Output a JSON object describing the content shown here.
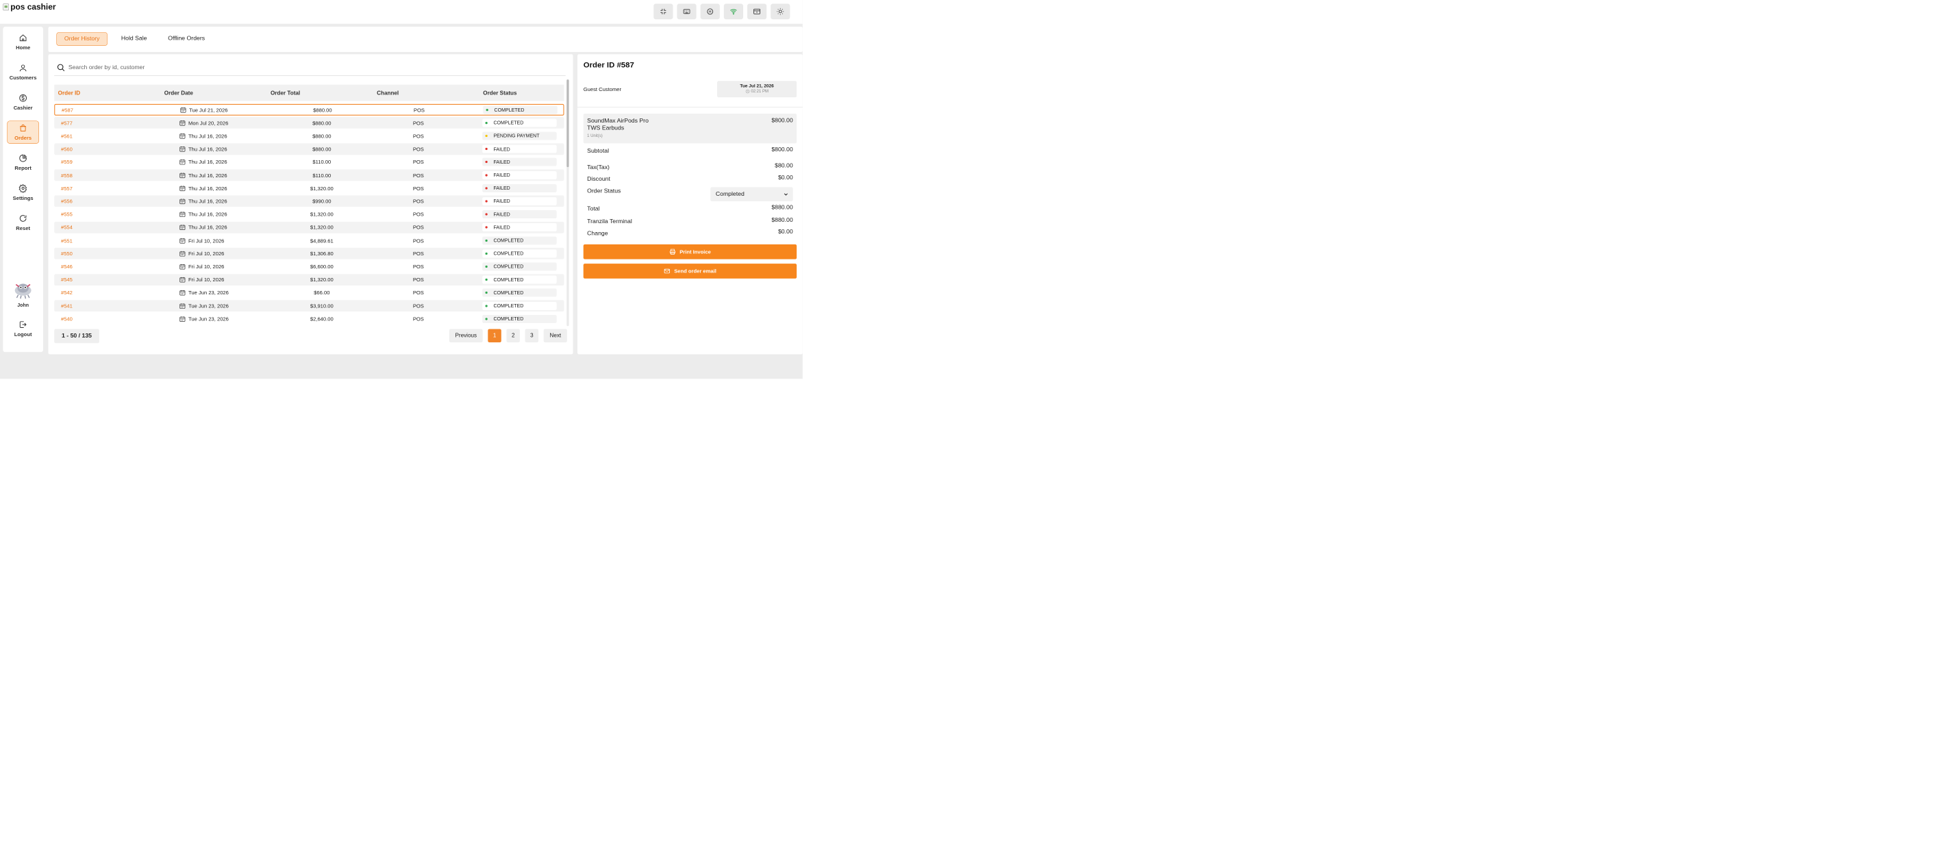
{
  "app": {
    "logo_alt": "pos cashier"
  },
  "colors": {
    "accent": "#f7861d",
    "completed": "#2fa84f",
    "failed": "#e0322b",
    "pending": "#f5c400"
  },
  "topbar": {
    "icons": [
      "fullscreen-icon",
      "keyboard-icon",
      "pause-icon",
      "wifi-icon",
      "cash-drawer-icon",
      "sun-icon"
    ]
  },
  "sidebar": {
    "items": [
      {
        "label": "Home",
        "icon": "home-icon"
      },
      {
        "label": "Customers",
        "icon": "user-icon"
      },
      {
        "label": "Cashier",
        "icon": "dollar-icon"
      },
      {
        "label": "Orders",
        "icon": "bag-icon",
        "active": true
      },
      {
        "label": "Report",
        "icon": "pie-chart-icon"
      },
      {
        "label": "Settings",
        "icon": "gear-icon"
      },
      {
        "label": "Reset",
        "icon": "refresh-icon"
      }
    ],
    "user_name": "John",
    "logout_label": "Logout"
  },
  "tabs": [
    {
      "label": "Order History",
      "active": true
    },
    {
      "label": "Hold Sale"
    },
    {
      "label": "Offline Orders"
    }
  ],
  "search": {
    "placeholder": "Search order by id, customer"
  },
  "table": {
    "headers": [
      "Order ID",
      "Order Date",
      "Order Total",
      "Channel",
      "Order Status"
    ],
    "rows": [
      {
        "id": "#587",
        "date": "Tue Jul 21, 2026",
        "total": "$880.00",
        "channel": "POS",
        "status": "COMPLETED",
        "tone": "completed"
      },
      {
        "id": "#577",
        "date": "Mon Jul 20, 2026",
        "total": "$880.00",
        "channel": "POS",
        "status": "COMPLETED",
        "tone": "completed"
      },
      {
        "id": "#561",
        "date": "Thu Jul 16, 2026",
        "total": "$880.00",
        "channel": "POS",
        "status": "PENDING PAYMENT",
        "tone": "pending"
      },
      {
        "id": "#560",
        "date": "Thu Jul 16, 2026",
        "total": "$880.00",
        "channel": "POS",
        "status": "FAILED",
        "tone": "failed"
      },
      {
        "id": "#559",
        "date": "Thu Jul 16, 2026",
        "total": "$110.00",
        "channel": "POS",
        "status": "FAILED",
        "tone": "failed"
      },
      {
        "id": "#558",
        "date": "Thu Jul 16, 2026",
        "total": "$110.00",
        "channel": "POS",
        "status": "FAILED",
        "tone": "failed"
      },
      {
        "id": "#557",
        "date": "Thu Jul 16, 2026",
        "total": "$1,320.00",
        "channel": "POS",
        "status": "FAILED",
        "tone": "failed"
      },
      {
        "id": "#556",
        "date": "Thu Jul 16, 2026",
        "total": "$990.00",
        "channel": "POS",
        "status": "FAILED",
        "tone": "failed"
      },
      {
        "id": "#555",
        "date": "Thu Jul 16, 2026",
        "total": "$1,320.00",
        "channel": "POS",
        "status": "FAILED",
        "tone": "failed"
      },
      {
        "id": "#554",
        "date": "Thu Jul 16, 2026",
        "total": "$1,320.00",
        "channel": "POS",
        "status": "FAILED",
        "tone": "failed"
      },
      {
        "id": "#551",
        "date": "Fri Jul 10, 2026",
        "total": "$4,889.61",
        "channel": "POS",
        "status": "COMPLETED",
        "tone": "completed"
      },
      {
        "id": "#550",
        "date": "Fri Jul 10, 2026",
        "total": "$1,306.80",
        "channel": "POS",
        "status": "COMPLETED",
        "tone": "completed"
      },
      {
        "id": "#546",
        "date": "Fri Jul 10, 2026",
        "total": "$6,600.00",
        "channel": "POS",
        "status": "COMPLETED",
        "tone": "completed"
      },
      {
        "id": "#545",
        "date": "Fri Jul 10, 2026",
        "total": "$1,320.00",
        "channel": "POS",
        "status": "COMPLETED",
        "tone": "completed"
      },
      {
        "id": "#542",
        "date": "Tue Jun 23, 2026",
        "total": "$66.00",
        "channel": "POS",
        "status": "COMPLETED",
        "tone": "completed"
      },
      {
        "id": "#541",
        "date": "Tue Jun 23, 2026",
        "total": "$3,910.00",
        "channel": "POS",
        "status": "COMPLETED",
        "tone": "completed"
      },
      {
        "id": "#540",
        "date": "Tue Jun 23, 2026",
        "total": "$2,640.00",
        "channel": "POS",
        "status": "COMPLETED",
        "tone": "completed"
      }
    ]
  },
  "pagination": {
    "range": "1 - 50 / 135",
    "previous": "Previous",
    "pages": [
      "1",
      "2",
      "3"
    ],
    "current": "1",
    "next": "Next"
  },
  "detail": {
    "title": "Order ID #587",
    "customer": "Guest Customer",
    "date": "Tue Jul 21, 2026",
    "time": "02:21 PM",
    "item": {
      "name": "SoundMax AirPods Pro TWS Earbuds",
      "qty": "1 Unit(s)",
      "price": "$800.00"
    },
    "subtotal_label": "Subtotal",
    "subtotal": "$800.00",
    "tax_label": "Tax(Tax)",
    "tax": "$80.00",
    "discount_label": "Discount",
    "discount": "$0.00",
    "status_label": "Order Status",
    "status_value": "Completed",
    "total_label": "Total",
    "total": "$880.00",
    "terminal_label": "Tranzila Terminal",
    "terminal": "$880.00",
    "change_label": "Change",
    "change": "$0.00",
    "print_label": "Print Invoice",
    "email_label": "Send order email"
  }
}
